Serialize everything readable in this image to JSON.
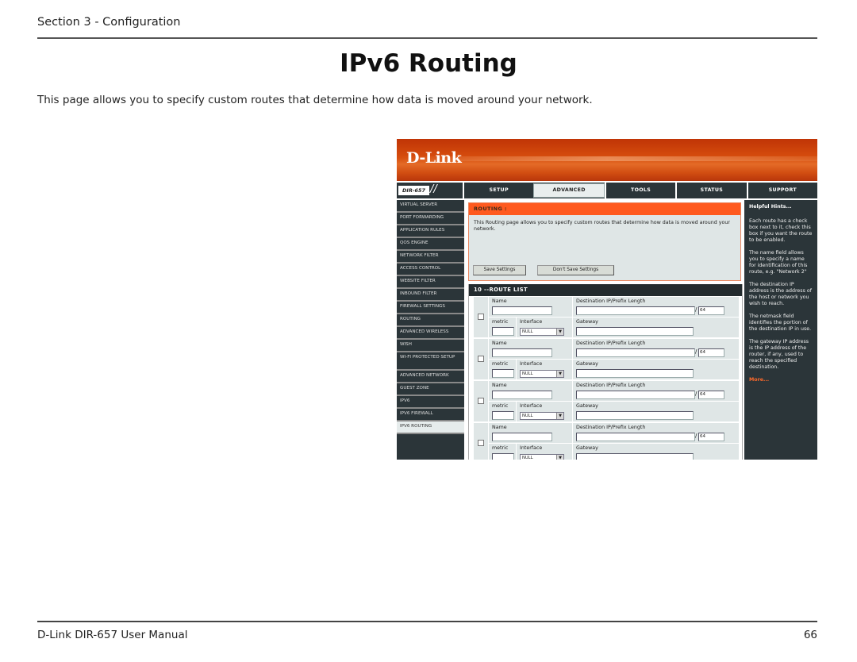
{
  "doc": {
    "section_header": "Section 3 - Configuration",
    "page_title": "IPv6 Routing",
    "intro": "This page allows you to specify custom routes that determine how data is moved around your network.",
    "footer_left": "D-Link DIR-657 User Manual",
    "footer_right": "66"
  },
  "router_ui": {
    "logo": "D-Link",
    "model": "DIR-657",
    "nav_tabs": [
      {
        "label": "SETUP",
        "active": false
      },
      {
        "label": "ADVANCED",
        "active": true
      },
      {
        "label": "TOOLS",
        "active": false
      },
      {
        "label": "STATUS",
        "active": false
      },
      {
        "label": "SUPPORT",
        "active": false
      }
    ],
    "sidebar": [
      "VIRTUAL SERVER",
      "PORT FORWARDING",
      "APPLICATION RULES",
      "QOS ENGINE",
      "NETWORK FILTER",
      "ACCESS CONTROL",
      "WEBSITE FILTER",
      "INBOUND FILTER",
      "FIREWALL SETTINGS",
      "ROUTING",
      "ADVANCED WIRELESS",
      "WISH",
      "WI-FI PROTECTED SETUP",
      "ADVANCED NETWORK",
      "GUEST ZONE",
      "IPV6",
      "IPV6 FIREWALL",
      "IPV6 ROUTING"
    ],
    "sidebar_active": "IPV6 ROUTING",
    "routing": {
      "heading": "ROUTING :",
      "description": "This Routing page allows you to specify custom routes that determine how data is moved around your network.",
      "save_label": "Save Settings",
      "dont_save_label": "Don't Save Settings"
    },
    "route_list": {
      "heading": "10 --ROUTE LIST",
      "labels": {
        "name": "Name",
        "dest": "Destination IP/Prefix Length",
        "metric": "metric",
        "interface": "Interface",
        "gateway": "Gateway"
      },
      "routes": [
        {
          "enabled": false,
          "name": "",
          "dest": "",
          "prefix": "64",
          "metric": "",
          "interface": "NULL",
          "gateway": ""
        },
        {
          "enabled": false,
          "name": "",
          "dest": "",
          "prefix": "64",
          "metric": "",
          "interface": "NULL",
          "gateway": ""
        },
        {
          "enabled": false,
          "name": "",
          "dest": "",
          "prefix": "64",
          "metric": "",
          "interface": "NULL",
          "gateway": ""
        },
        {
          "enabled": false,
          "name": "",
          "dest": "",
          "prefix": "64",
          "metric": "",
          "interface": "NULL",
          "gateway": ""
        }
      ]
    },
    "hints": {
      "title": "Helpful Hints...",
      "items": [
        "Each route has a check box next to it, check this box if you want the route to be enabled.",
        "The name field allows you to specify a name for identification of this route, e.g. \"Network 2\"",
        "The destination IP address is the address of the host or network you wish to reach.",
        "The netmask field identifies the portion of the destination IP in use.",
        "The gateway IP address is the IP address of the router, if any, used to reach the specified destination."
      ],
      "more": "More..."
    },
    "colors": {
      "brand_orange": "#ff5a1f",
      "dark_panel": "#2b3539",
      "light_panel": "#dfe6e6"
    }
  }
}
